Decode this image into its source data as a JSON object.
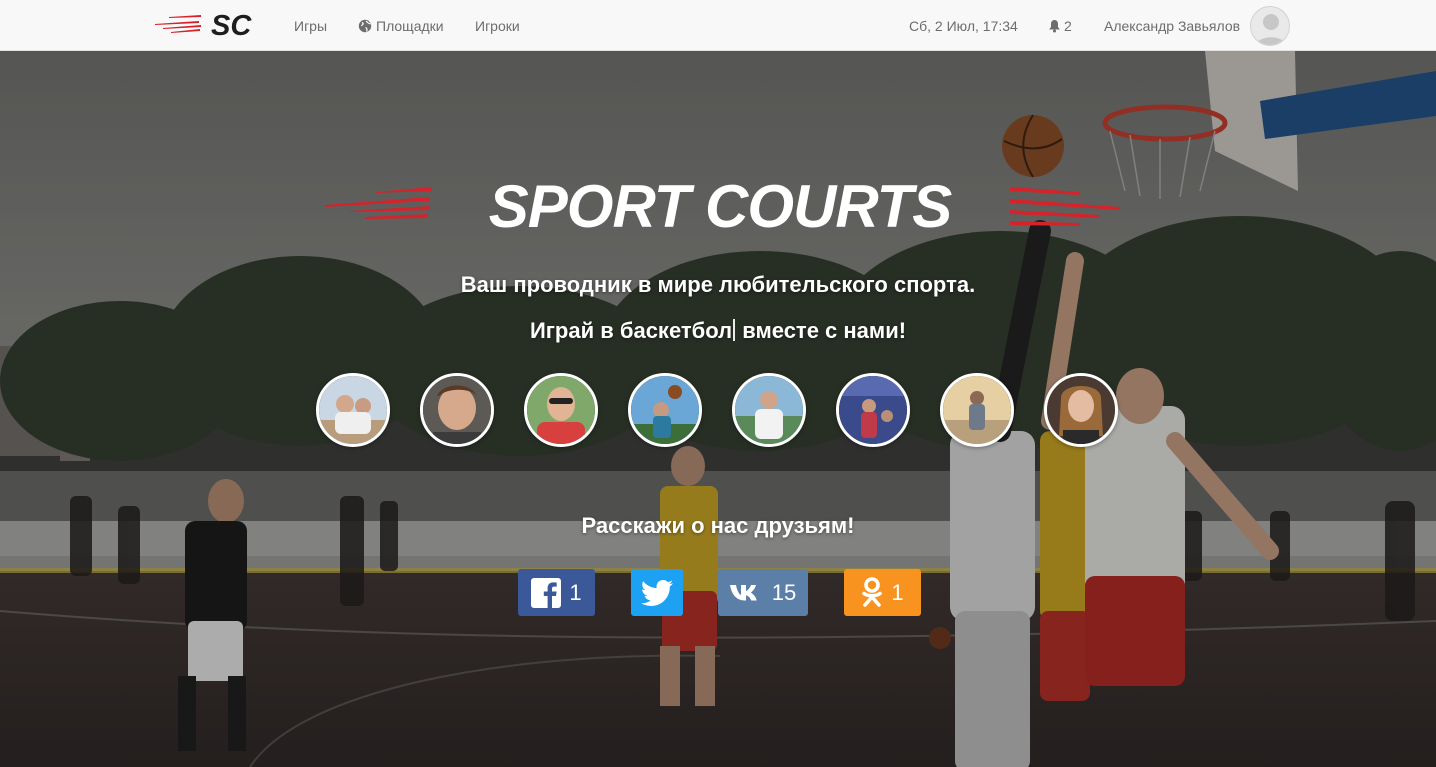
{
  "nav": {
    "logo_text": "SC",
    "links": [
      {
        "label": "Игры"
      },
      {
        "label": "Площадки"
      },
      {
        "label": "Игроки"
      }
    ],
    "datetime": "Сб, 2 Июл, 17:34",
    "notifications_count": "2",
    "user_name": "Александр Завьялов"
  },
  "hero": {
    "brand_title": "SPORT COURTS",
    "tagline": "Ваш проводник в мире любительского спорта.",
    "subtagline_prefix": "Играй в ",
    "subtagline_word": "баскетбол",
    "subtagline_suffix": " вместе с нами!",
    "share_title": "Расскажи о нас друзьям!"
  },
  "share": {
    "facebook_count": "1",
    "vk_count": "15",
    "ok_count": "1"
  },
  "colors": {
    "brand_red": "#d4232b",
    "facebook": "#3b5998",
    "twitter": "#1da1f2",
    "vk": "#5b7fa6",
    "odnoklassniki": "#f7931e"
  },
  "icons": [
    "globe-icon",
    "bell-icon",
    "facebook-icon",
    "twitter-icon",
    "vk-icon",
    "odnoklassniki-icon"
  ]
}
